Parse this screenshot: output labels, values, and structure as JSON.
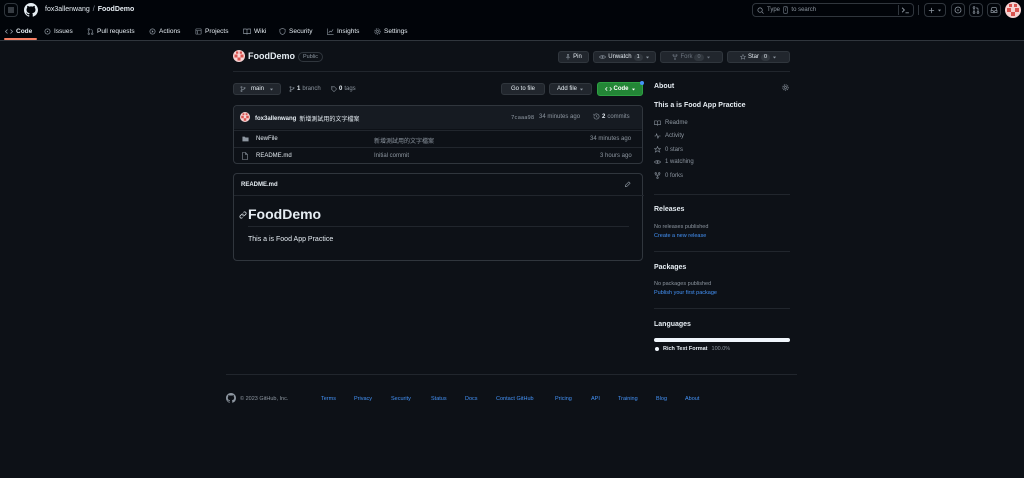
{
  "header": {
    "owner": "fox3allenwang",
    "separator": "/",
    "repo": "FoodDemo",
    "search_placeholder_pre": "Type",
    "search_key": "/",
    "search_placeholder_post": "to search"
  },
  "tabs": [
    {
      "label": "Code"
    },
    {
      "label": "Issues"
    },
    {
      "label": "Pull requests"
    },
    {
      "label": "Actions"
    },
    {
      "label": "Projects"
    },
    {
      "label": "Wiki"
    },
    {
      "label": "Security"
    },
    {
      "label": "Insights"
    },
    {
      "label": "Settings"
    }
  ],
  "repo": {
    "name": "FoodDemo",
    "visibility": "Public",
    "pin": "Pin",
    "unwatch": "Unwatch",
    "watch_count": "1",
    "fork": "Fork",
    "fork_count": "0",
    "star": "Star",
    "star_count": "0"
  },
  "toolbar": {
    "branch": "main",
    "branches_count": "1",
    "branches_label": "branch",
    "tags_count": "0",
    "tags_label": "tags",
    "go_to_file": "Go to file",
    "add_file": "Add file",
    "code": "Code"
  },
  "commit": {
    "author": "fox3allenwang",
    "message": "新增測試用的文字檔案",
    "hash": "7caaa98",
    "time": "34 minutes ago",
    "commits_count": "2",
    "commits_label": "commits"
  },
  "files": [
    {
      "name": "NewFile",
      "message": "新增測試用的文字檔案",
      "time": "34 minutes ago"
    },
    {
      "name": "README.md",
      "message": "Initial commit",
      "time": "3 hours ago"
    }
  ],
  "readme": {
    "filename": "README.md",
    "heading": "FoodDemo",
    "body": "This a is Food App Practice"
  },
  "about": {
    "title": "About",
    "description": "This a is Food App Practice",
    "items": [
      "Readme",
      "Activity",
      "0 stars",
      "1 watching",
      "0 forks"
    ]
  },
  "releases": {
    "title": "Releases",
    "empty": "No releases published",
    "link": "Create a new release"
  },
  "packages": {
    "title": "Packages",
    "empty": "No packages published",
    "link": "Publish your first package"
  },
  "languages": {
    "title": "Languages",
    "name": "Rich Text Format",
    "percent": "100.0%",
    "color": "#f0f6fc"
  },
  "footer": {
    "copyright": "© 2023 GitHub, Inc.",
    "links": [
      "Terms",
      "Privacy",
      "Security",
      "Status",
      "Docs",
      "Contact GitHub",
      "Pricing",
      "API",
      "Training",
      "Blog",
      "About"
    ]
  },
  "colors": {
    "accent": "#238636",
    "link": "#4493f8",
    "tab_underline": "#f78166"
  }
}
